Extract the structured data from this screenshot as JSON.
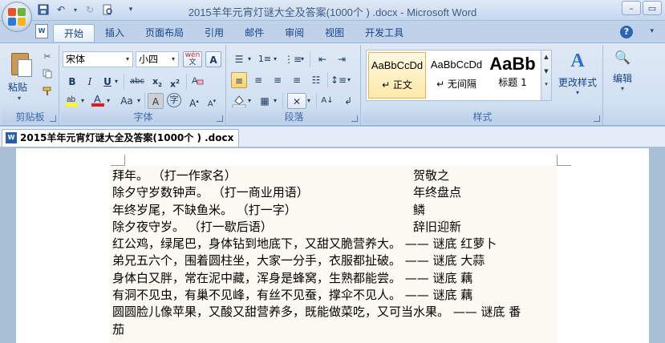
{
  "window": {
    "title": "2015羊年元宵灯谜大全及答案(1000个 ) .docx - Microsoft Word"
  },
  "tabs": [
    "开始",
    "插入",
    "页面布局",
    "引用",
    "邮件",
    "审阅",
    "视图",
    "开发工具"
  ],
  "ribbon": {
    "clipboard": {
      "paste_label": "粘贴",
      "group_label": "剪贴板"
    },
    "font": {
      "font_name": "宋体",
      "font_size": "小四",
      "wen_label": "wén",
      "group_label": "字体"
    },
    "paragraph": {
      "group_label": "段落"
    },
    "styles": {
      "items": [
        {
          "preview": "AaBbCcDd",
          "name": "↵ 正文"
        },
        {
          "preview": "AaBbCcDd",
          "name": "↵ 无间隔"
        },
        {
          "preview": "AaBb",
          "name": "标题 1"
        }
      ],
      "change_styles": "更改样式",
      "group_label": "样式"
    },
    "editing": {
      "label": "编辑"
    }
  },
  "document": {
    "tab_label": "2015羊年元宵灯谜大全及答案(1000个 ) .docx",
    "lines": [
      {
        "text": "拜年。 （打一作家名）",
        "answer": "贺敬之"
      },
      {
        "text": "除夕守岁数钟声。 （打一商业用语）",
        "answer": "年终盘点"
      },
      {
        "text": "年终岁尾，不缺鱼米。 （打一字）",
        "answer": "鳞"
      },
      {
        "text": "除夕夜守岁。 （打一歇后语）",
        "answer": "辞旧迎新"
      },
      {
        "text": "红公鸡，绿尾巴，身体钻到地底下，又甜又脆营养大。 —— 谜底 红萝卜",
        "answer": ""
      },
      {
        "text": "弟兄五六个，围着圆柱坐，大家一分手，衣服都扯破。 —— 谜底 大蒜",
        "answer": ""
      },
      {
        "text": "身体白又胖，常在泥中藏，浑身是蜂窝，生熟都能尝。 —— 谜底 藕",
        "answer": ""
      },
      {
        "text": "有洞不见虫，有巢不见峰，有丝不见蚕，撑伞不见人。 —— 谜底 藕",
        "answer": ""
      },
      {
        "text": "圆圆脸儿像苹果，又酸又甜营养多，既能做菜吃，又可当水果。 —— 谜底 番",
        "answer": ""
      },
      {
        "text": "茄",
        "answer": ""
      }
    ]
  }
}
